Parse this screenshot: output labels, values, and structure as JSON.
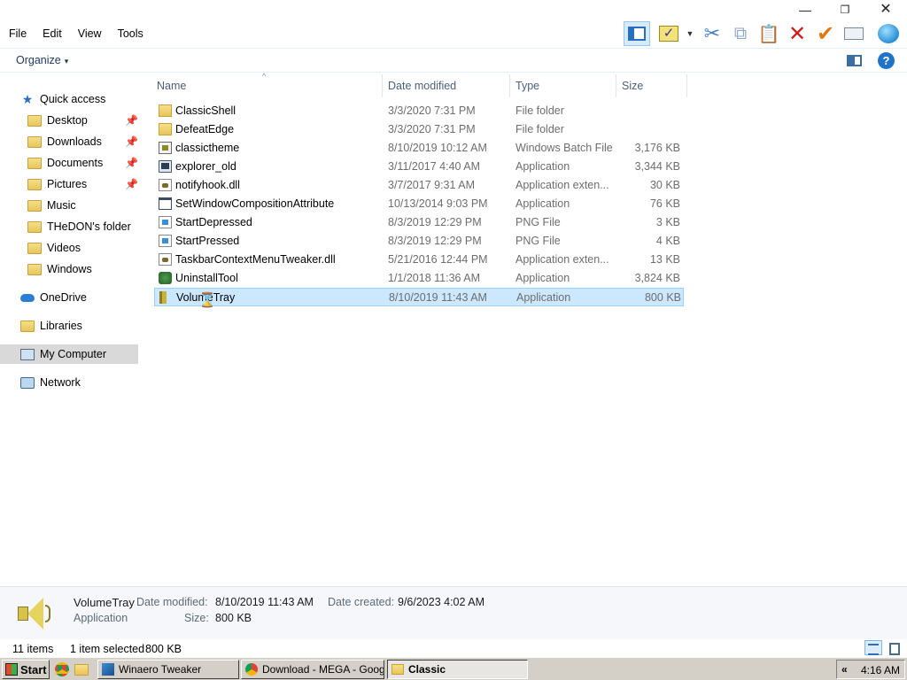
{
  "window": {
    "minimize_glyph": "—",
    "maximize_glyph": "❐",
    "close_glyph": "✕"
  },
  "menu": [
    "File",
    "Edit",
    "View",
    "Tools"
  ],
  "toolbar": {
    "icons": [
      "preview-pane-icon",
      "properties-icon",
      "cut-icon",
      "copy-icon",
      "paste-icon",
      "delete-icon",
      "checkmark-icon",
      "rename-icon",
      "globe-icon"
    ],
    "cut_glyph": "✂",
    "copy_glyph": "⧉",
    "paste_glyph": "📋",
    "delete_glyph": "✕",
    "check_glyph": "✔",
    "props_glyph": "✓",
    "drop_glyph": "▼"
  },
  "command_bar": {
    "organize_label": "Organize",
    "organize_arrow": "▾",
    "help_glyph": "?"
  },
  "nav": {
    "items": [
      {
        "label": "Quick access",
        "icon": "star-icon",
        "pinned": false
      },
      {
        "label": "Desktop",
        "icon": "folder-icon",
        "pinned": true
      },
      {
        "label": "Downloads",
        "icon": "folder-icon",
        "pinned": true
      },
      {
        "label": "Documents",
        "icon": "folder-icon",
        "pinned": true
      },
      {
        "label": "Pictures",
        "icon": "folder-icon",
        "pinned": true
      },
      {
        "label": "Music",
        "icon": "folder-icon",
        "pinned": false
      },
      {
        "label": "THeDON's folder",
        "icon": "folder-icon",
        "pinned": false
      },
      {
        "label": "Videos",
        "icon": "folder-icon",
        "pinned": false
      },
      {
        "label": "Windows",
        "icon": "folder-icon",
        "pinned": false
      },
      {
        "label": "OneDrive",
        "icon": "cloud-icon",
        "pinned": false
      },
      {
        "label": "Libraries",
        "icon": "folder-icon",
        "pinned": false
      },
      {
        "label": "My Computer",
        "icon": "computer-icon",
        "pinned": false,
        "selected": true
      },
      {
        "label": "Network",
        "icon": "network-icon",
        "pinned": false
      }
    ],
    "pin_glyph": "📌",
    "star_glyph": "★"
  },
  "columns": {
    "name": "Name",
    "date": "Date modified",
    "type": "Type",
    "size": "Size",
    "sort_glyph": "^"
  },
  "files": [
    {
      "name": "ClassicShell",
      "date": "3/3/2020 7:31 PM",
      "type": "File folder",
      "size": "",
      "icon": "folder-icon"
    },
    {
      "name": "DefeatEdge",
      "date": "3/3/2020 7:31 PM",
      "type": "File folder",
      "size": "",
      "icon": "folder-icon"
    },
    {
      "name": "classictheme",
      "date": "8/10/2019 10:12 AM",
      "type": "Windows Batch File",
      "size": "3,176 KB",
      "icon": "batch-file-icon"
    },
    {
      "name": "explorer_old",
      "date": "3/11/2017 4:40 AM",
      "type": "Application",
      "size": "3,344 KB",
      "icon": "application-icon"
    },
    {
      "name": "notifyhook.dll",
      "date": "3/7/2017 9:31 AM",
      "type": "Application exten...",
      "size": "30 KB",
      "icon": "dll-icon"
    },
    {
      "name": "SetWindowCompositionAttribute",
      "date": "10/13/2014 9:03 PM",
      "type": "Application",
      "size": "76 KB",
      "icon": "window-icon"
    },
    {
      "name": "StartDepressed",
      "date": "8/3/2019 12:29 PM",
      "type": "PNG File",
      "size": "3 KB",
      "icon": "png-icon"
    },
    {
      "name": "StartPressed",
      "date": "8/3/2019 12:29 PM",
      "type": "PNG File",
      "size": "4 KB",
      "icon": "png-icon"
    },
    {
      "name": "TaskbarContextMenuTweaker.dll",
      "date": "5/21/2016 12:44 PM",
      "type": "Application exten...",
      "size": "13 KB",
      "icon": "dll-icon"
    },
    {
      "name": "UninstallTool",
      "date": "1/1/2018 11:36 AM",
      "type": "Application",
      "size": "3,824 KB",
      "icon": "uninstall-tool-icon"
    },
    {
      "name": "VolumeTray",
      "date": "8/10/2019 11:43 AM",
      "type": "Application",
      "size": "800 KB",
      "icon": "speaker-icon",
      "selected": true
    }
  ],
  "cursor_glyph": "⌛",
  "details": {
    "name": "VolumeTray",
    "kind": "Application",
    "date_modified_label": "Date modified:",
    "date_modified": "8/10/2019 11:43 AM",
    "date_created_label": "Date created:",
    "date_created": "9/6/2023 4:02 AM",
    "size_label": "Size:",
    "size": "800 KB"
  },
  "status": {
    "count": "11 items",
    "selected": "1 item selected",
    "size": "800 KB"
  },
  "taskbar": {
    "start_label": "Start",
    "tasks": [
      "Winaero Tweaker",
      "Download - MEGA - Googl...",
      "Classic"
    ],
    "chevron": "«",
    "clock": "4:16 AM"
  }
}
